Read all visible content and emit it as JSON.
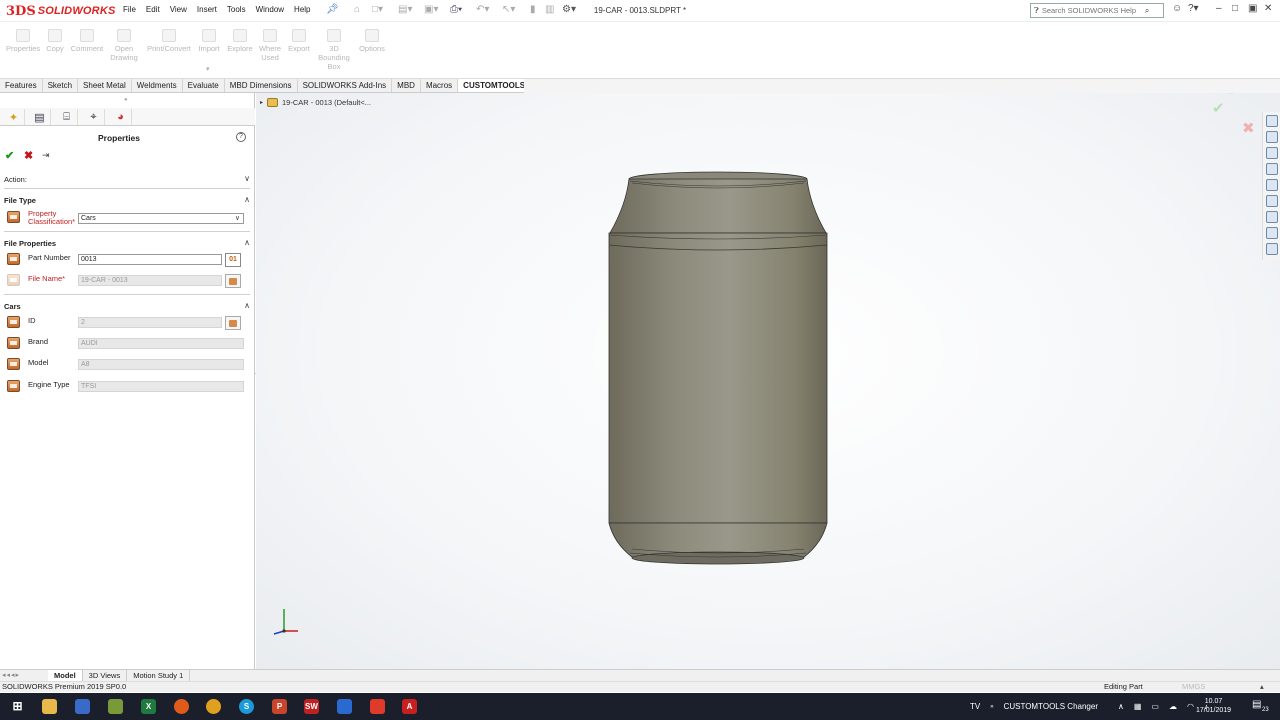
{
  "app": {
    "logo_ds": "3DS",
    "logo_name": "SOLIDWORKS",
    "document_title": "19-CAR - 0013.SLDPRT *"
  },
  "menu": [
    "File",
    "Edit",
    "View",
    "Insert",
    "Tools",
    "Window",
    "Help"
  ],
  "search": {
    "placeholder": "Search SOLIDWORKS Help"
  },
  "commands": [
    {
      "label": "Properties"
    },
    {
      "label": "Copy"
    },
    {
      "label": "Comment"
    },
    {
      "label": "Open\nDrawing"
    },
    {
      "label": "Print/Convert"
    },
    {
      "label": "Import"
    },
    {
      "label": "Explore"
    },
    {
      "label": "Where\nUsed"
    },
    {
      "label": "Export"
    },
    {
      "label": "3D\nBounding\nBox"
    },
    {
      "label": "Options"
    }
  ],
  "tabs": [
    {
      "label": "Features",
      "active": false
    },
    {
      "label": "Sketch",
      "active": false
    },
    {
      "label": "Sheet Metal",
      "active": false
    },
    {
      "label": "Weldments",
      "active": false
    },
    {
      "label": "Evaluate",
      "active": false
    },
    {
      "label": "MBD Dimensions",
      "active": false
    },
    {
      "label": "SOLIDWORKS Add-Ins",
      "active": false
    },
    {
      "label": "MBD",
      "active": false
    },
    {
      "label": "Macros",
      "active": false
    },
    {
      "label": "CUSTOMTOOLS",
      "active": true
    }
  ],
  "panel": {
    "title": "Properties",
    "action_label": "Action:",
    "file_type": {
      "header": "File Type",
      "property_classification_label": "Property\nClassification*",
      "property_classification_value": "Cars"
    },
    "file_properties": {
      "header": "File Properties",
      "part_number_label": "Part Number",
      "part_number_value": "0013",
      "part_number_button": "01",
      "file_name_label": "File Name*",
      "file_name_value": "19-CAR - 0013"
    },
    "cars": {
      "header": "Cars",
      "id_label": "ID",
      "id_value": "2",
      "brand_label": "Brand",
      "brand_value": "AUDI",
      "model_label": "Model",
      "model_value": "A8",
      "engine_label": "Engine Type",
      "engine_value": "TFSI"
    }
  },
  "graphics": {
    "tree_root": "19-CAR - 0013  (Default<..."
  },
  "bottom_tabs": [
    {
      "label": "Model",
      "active": true
    },
    {
      "label": "3D Views",
      "active": false
    },
    {
      "label": "Motion Study 1",
      "active": false
    }
  ],
  "status": {
    "version": "SOLIDWORKS Premium 2019 SP0.0",
    "mode": "Editing Part",
    "units": "MMGS"
  },
  "taskbar": {
    "tray_left": "TV",
    "tray_app": "CUSTOMTOOLS Changer",
    "time": "10.07",
    "date": "17/01/2019",
    "notif": "23"
  }
}
